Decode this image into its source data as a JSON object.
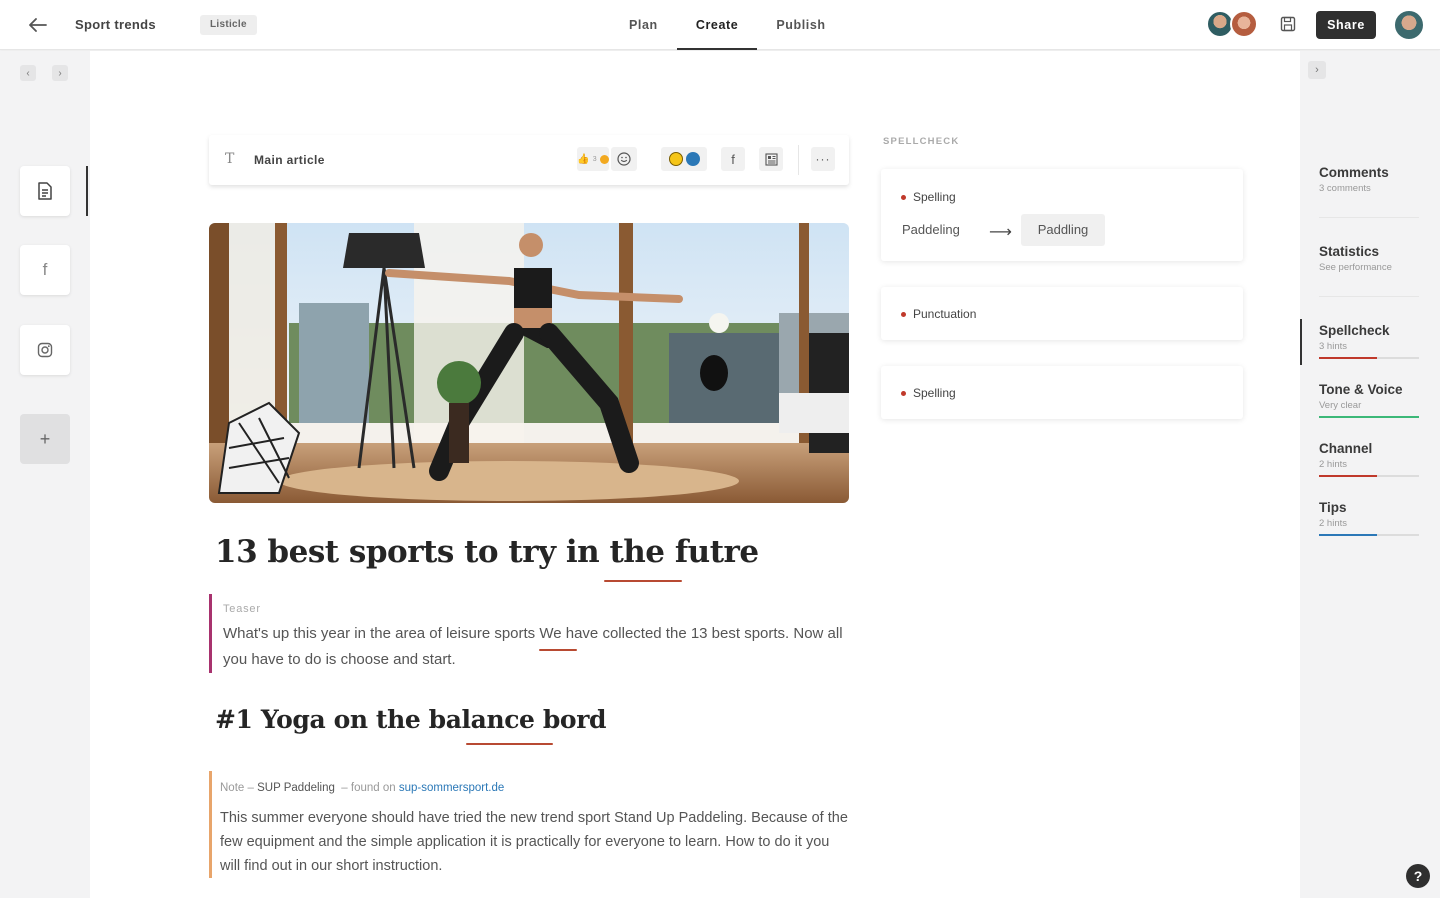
{
  "header": {
    "doc_title": "Sport trends",
    "doc_type": "Listicle",
    "tabs": [
      {
        "label": "Plan"
      },
      {
        "label": "Create"
      },
      {
        "label": "Publish"
      }
    ],
    "active_tab": "Create",
    "share_label": "Share"
  },
  "block": {
    "type_icon": "T",
    "label": "Main article",
    "reaction_count": "3"
  },
  "article": {
    "headline": "13 best sports to try in the futre",
    "teaser_label": "Teaser",
    "teaser_text": "What's up this year in the area of leisure sports We have collected the 13 best sports. Now all you have to do is choose and start.",
    "subheading": "#1 Yoga on the balance bord",
    "note_label": "Note",
    "note_source": "SUP Paddeling",
    "note_found_on": "found on",
    "note_link": "sup-sommersport.de",
    "note_text": "This summer everyone should have tried the new trend sport Stand Up Paddeling. Because of the few equipment and the simple application it is practically for everyone to learn. How to do it you will find out in our short instruction."
  },
  "spellcheck": {
    "heading": "SPELLCHECK",
    "cards": [
      {
        "title": "Spelling",
        "wrong": "Paddeling",
        "suggestion": "Paddling"
      },
      {
        "title": "Punctuation"
      },
      {
        "title": "Spelling"
      }
    ]
  },
  "sidebar": {
    "items": [
      {
        "title": "Comments",
        "subtitle": "3 comments"
      },
      {
        "title": "Statistics",
        "subtitle": "See performance"
      },
      {
        "title": "Spellcheck",
        "subtitle": "3 hints",
        "progress": 0.58,
        "color": "#c0392b"
      },
      {
        "title": "Tone & Voice",
        "subtitle": "Very clear",
        "progress": 1.0,
        "color": "#3cb878"
      },
      {
        "title": "Channel",
        "subtitle": "2 hints",
        "progress": 0.58,
        "color": "#c0392b"
      },
      {
        "title": "Tips",
        "subtitle": "2 hints",
        "progress": 0.58,
        "color": "#2b78b7"
      }
    ]
  },
  "help_label": "?",
  "colors": {
    "accent_dark": "#2f2f2f",
    "error": "#c0392b",
    "teaser_border": "#a8326e",
    "note_border": "#e8a56b",
    "link": "#2b78b7"
  }
}
